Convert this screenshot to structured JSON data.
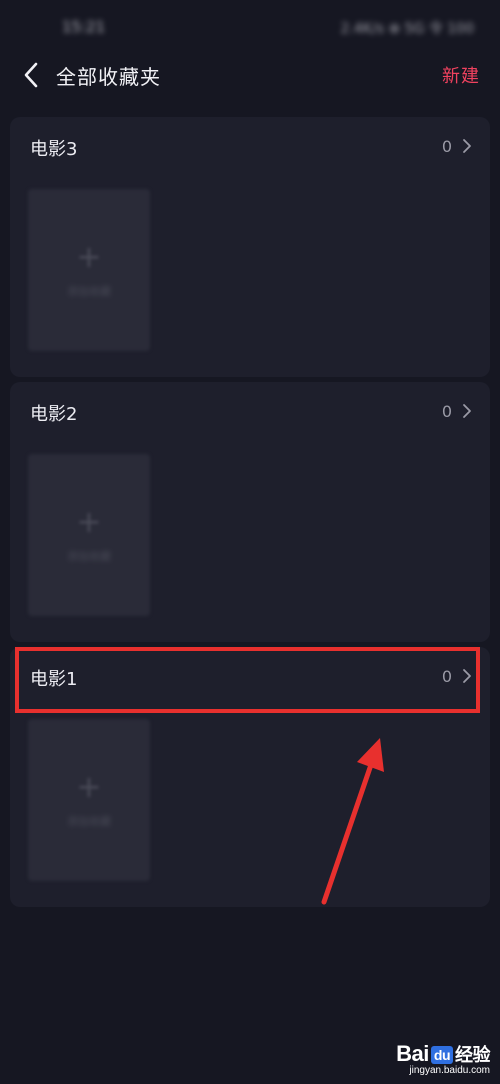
{
  "status_bar": {
    "time": "15:21",
    "right_info": "2.4K/s ⊕ 5G 令 100"
  },
  "nav": {
    "title": "全部收藏夹",
    "new_label": "新建"
  },
  "folders": [
    {
      "name": "电影3",
      "count": "0",
      "add_label": "添加收藏"
    },
    {
      "name": "电影2",
      "count": "0",
      "add_label": "添加收藏"
    },
    {
      "name": "电影1",
      "count": "0",
      "add_label": "添加收藏"
    }
  ],
  "colors": {
    "background": "#161722",
    "card": "#1e1f2c",
    "accent": "#f0425f",
    "annotation": "#e8302e"
  },
  "watermark": {
    "logo_left": "Bai",
    "logo_du": "du",
    "logo_right": "经验",
    "url": "jingyan.baidu.com"
  }
}
